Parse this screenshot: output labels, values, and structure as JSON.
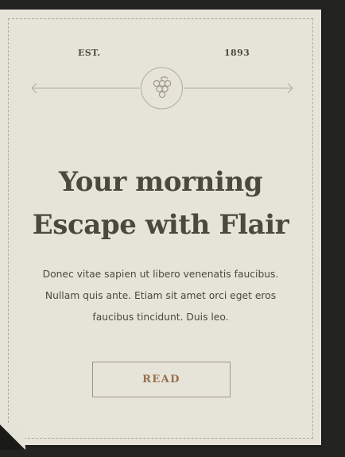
{
  "header": {
    "est": "EST.",
    "year": "1893",
    "emblem_icon": "grapes-icon"
  },
  "hero": {
    "headline_line1": "Your morning",
    "headline_line2": "Escape with Flair",
    "body_line1": "Donec vitae sapien ut libero venenatis faucibus.",
    "body_line2": "Nullam quis ante. Etiam sit amet orci eget eros",
    "body_line3": "faucibus tincidunt. Duis leo."
  },
  "cta": {
    "read_label": "READ"
  },
  "colors": {
    "background": "#e6e3d8",
    "text": "#4b483f",
    "accent": "#98704c",
    "line": "#b1ac9c"
  }
}
